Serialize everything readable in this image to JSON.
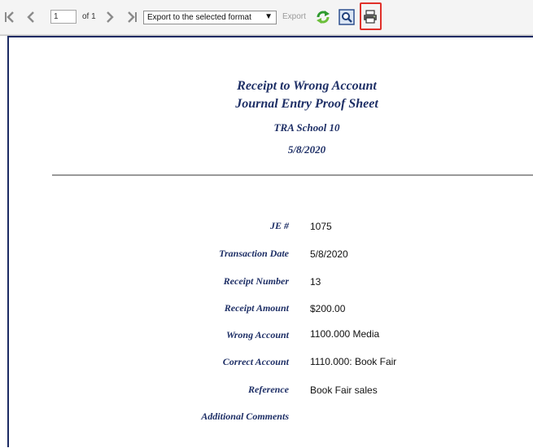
{
  "toolbar": {
    "page_value": "1",
    "of_text": "of 1",
    "export_format": "Export to the selected format",
    "export_label": "Export",
    "highlight_color": "#e0302a",
    "icons": [
      "first-page-icon",
      "previous-page-icon",
      "next-page-icon",
      "last-page-icon",
      "refresh-icon",
      "find-icon",
      "print-icon"
    ]
  },
  "report": {
    "title_line1": "Receipt to Wrong Account",
    "title_line2": "Journal Entry Proof Sheet",
    "school": "TRA School 10",
    "date": "5/8/2020",
    "title_color": "#1e2f66",
    "fields": [
      {
        "label": "JE #",
        "value": "1075"
      },
      {
        "label": "Transaction Date",
        "value": "5/8/2020"
      },
      {
        "label": "Receipt Number",
        "value": "13"
      },
      {
        "label": "Receipt Amount",
        "value": "$200.00"
      },
      {
        "label": "Wrong Account",
        "value": "1100.000 Media"
      },
      {
        "label": "Correct Account",
        "value": "1110.000: Book Fair"
      },
      {
        "label": "Reference",
        "value": "Book Fair sales"
      },
      {
        "label": "Additional Comments",
        "value": ""
      }
    ]
  }
}
